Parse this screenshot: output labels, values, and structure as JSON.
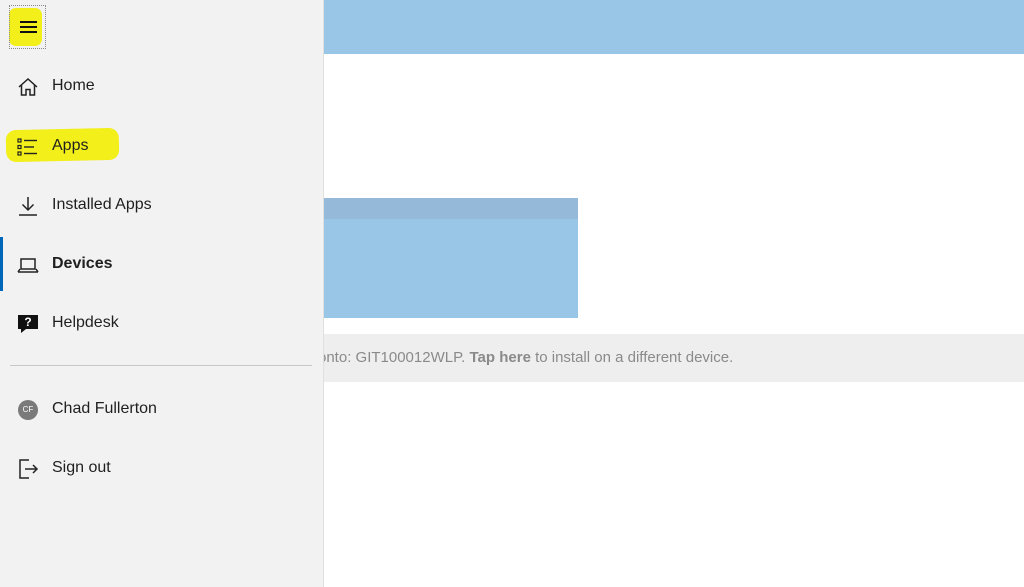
{
  "background": {
    "install_bar": {
      "prefix": "onto: GIT100012WLP. ",
      "link": "Tap here",
      "suffix": " to install on a different device."
    }
  },
  "nav": {
    "menu_icon": "hamburger-icon",
    "items": [
      {
        "label": "Home",
        "icon": "home-icon"
      },
      {
        "label": "Apps",
        "icon": "apps-list-icon"
      },
      {
        "label": "Installed Apps",
        "icon": "download-icon"
      },
      {
        "label": "Devices",
        "icon": "laptop-icon",
        "active": true
      },
      {
        "label": "Helpdesk",
        "icon": "help-chat-icon"
      }
    ],
    "user": {
      "name": "Chad Fullerton",
      "initials": "CF"
    },
    "sign_out": {
      "label": "Sign out",
      "icon": "sign-out-icon"
    }
  },
  "colors": {
    "accent": "#0067b8",
    "highlight": "#f2ef1a",
    "header_blue": "#99c6e6",
    "pane": "#f2f2f2"
  }
}
